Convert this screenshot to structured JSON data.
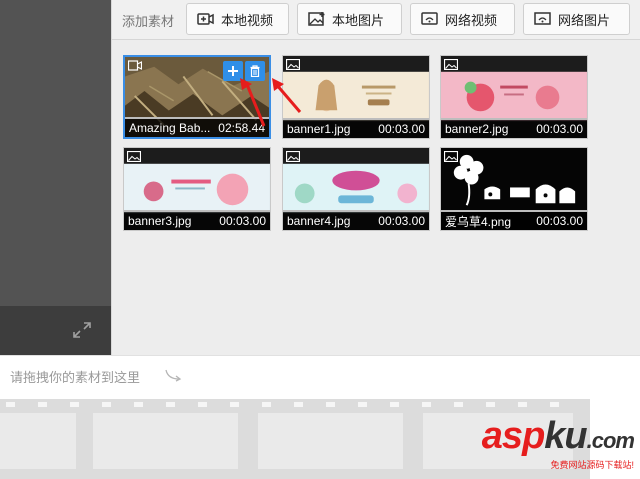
{
  "toolbar": {
    "label": "添加素材",
    "buttons": [
      {
        "label": "本地视频",
        "icon": "video-add-icon"
      },
      {
        "label": "本地图片",
        "icon": "image-add-icon"
      },
      {
        "label": "网络视频",
        "icon": "web-video-icon"
      },
      {
        "label": "网络图片",
        "icon": "web-image-icon"
      }
    ]
  },
  "media": [
    {
      "name": "Amazing Bab...",
      "duration": "02:58.44",
      "type": "video",
      "selected": true
    },
    {
      "name": "banner1.jpg",
      "duration": "00:03.00",
      "type": "image"
    },
    {
      "name": "banner2.jpg",
      "duration": "00:03.00",
      "type": "image"
    },
    {
      "name": "banner3.jpg",
      "duration": "00:03.00",
      "type": "image"
    },
    {
      "name": "banner4.jpg",
      "duration": "00:03.00",
      "type": "image"
    },
    {
      "name": "爱乌草4.png",
      "duration": "00:03.00",
      "type": "image"
    }
  ],
  "timeline": {
    "hint": "请拖拽你的素材到这里"
  },
  "watermark": {
    "brand_a": "asp",
    "brand_b": "ku",
    "brand_c": ".com",
    "tagline": "免费网站源码下载站!"
  },
  "colors": {
    "accent": "#2f8fe8",
    "annotation": "#e61d1d"
  }
}
